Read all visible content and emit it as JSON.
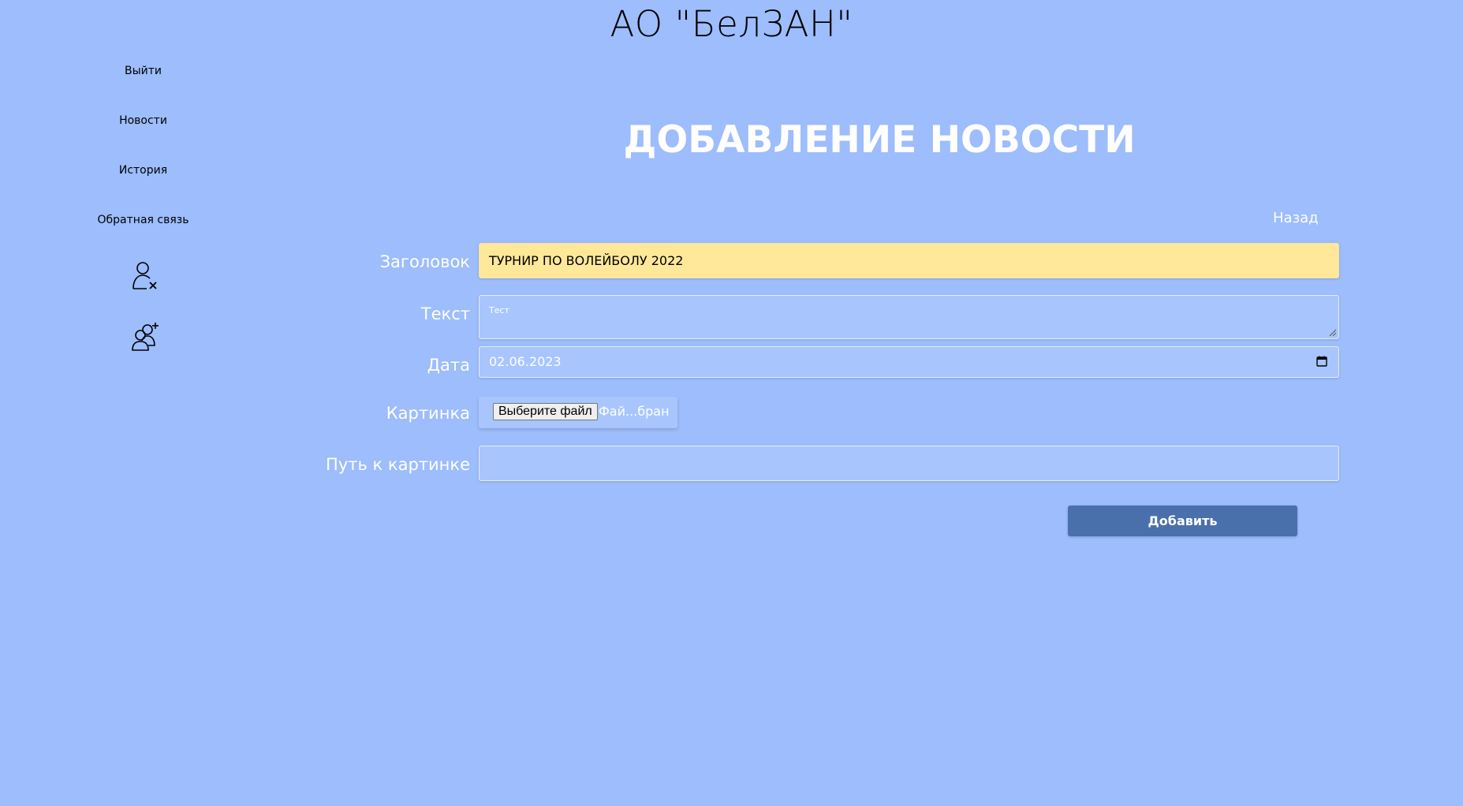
{
  "header": {
    "site_title": "АО \"БелЗАН\""
  },
  "sidebar": {
    "items": [
      {
        "label": "Выйти"
      },
      {
        "label": "Новости"
      },
      {
        "label": "История"
      },
      {
        "label": "Обратная связь"
      }
    ],
    "icons": [
      {
        "icon": "user-remove-icon"
      },
      {
        "icon": "users-add-icon"
      }
    ]
  },
  "main": {
    "heading": "ДОБАВЛЕНИЕ НОВОСТИ",
    "back_label": "Назад",
    "form": {
      "title_label": "Заголовок",
      "title_value": "ТУРНИР ПО ВОЛЕЙБОЛУ 2022",
      "text_label": "Текст",
      "text_value": "Тест",
      "date_label": "Дата",
      "date_value": "02.06.2023",
      "image_label": "Картинка",
      "file_button_label": "Выберите файл",
      "file_status": "Фай...бран",
      "path_label": "Путь к картинке",
      "path_value": "",
      "submit_label": "Добавить"
    }
  },
  "colors": {
    "background": "#9dbdfc",
    "field_background": "#a8c6fd",
    "focused_field": "#ffe899",
    "button": "#4a70ab"
  }
}
